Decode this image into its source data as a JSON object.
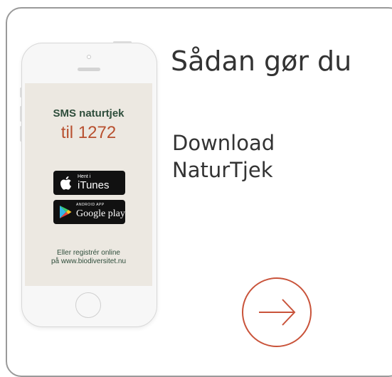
{
  "heading": "Sådan gør du",
  "subheading_line1": "Download",
  "subheading_line2": "NaturTjek",
  "phone_screen": {
    "sms_text": "SMS naturtjek",
    "sms_number": "til 1272",
    "itunes_small": "Hent i",
    "itunes_big": "iTunes",
    "gplay_small": "ANDROID APP",
    "gplay_big": "Google play",
    "register_line1": "Eller registrér online",
    "register_line2": "på www.biodiversitet.nu"
  },
  "colors": {
    "accent": "#c9533a",
    "text_dark": "#333333",
    "green_text": "#2e4d3b",
    "orange_text": "#b8502f",
    "card_border": "#9a9a9a"
  },
  "icons": [
    "apple-icon",
    "google-play-icon",
    "arrow-right-icon"
  ]
}
